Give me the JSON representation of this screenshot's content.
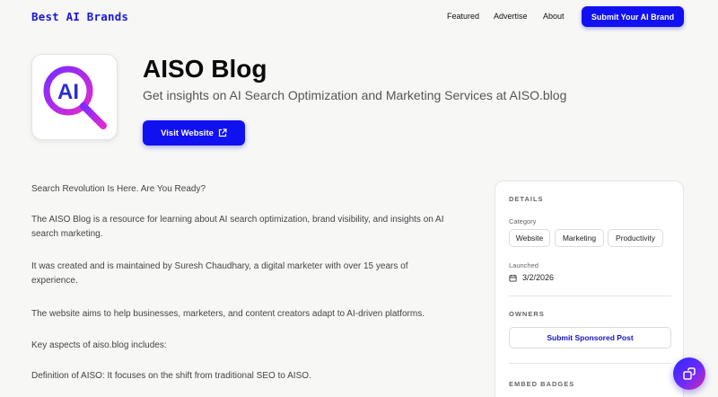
{
  "header": {
    "brand": "Best AI Brands",
    "nav": [
      "Featured",
      "Advertise",
      "About"
    ],
    "submit_label": "Submit Your AI Brand"
  },
  "hero": {
    "logo_text": "AI",
    "title": "AISO Blog",
    "subtitle": "Get insights on AI Search Optimization and Marketing Services at AISO.blog",
    "visit_label": "Visit Website"
  },
  "article": {
    "paragraphs": [
      "Search Revolution Is Here. Are You Ready?",
      "The AISO Blog is a resource for learning about AI search optimization, brand visibility, and insights on AI search marketing.",
      "It was created and is maintained by Suresh Chaudhary, a digital marketer with over 15 years of experience.",
      "The website aims to help businesses, marketers, and content creators adapt to AI-driven platforms.",
      "Key aspects of aiso.blog includes:",
      "Definition of AISO: It focuses on the shift from traditional SEO to AISO."
    ]
  },
  "details": {
    "heading": "DETAILS",
    "category_label": "Category",
    "categories": [
      "Website",
      "Marketing",
      "Productivity"
    ],
    "launched_label": "Launched",
    "launched_date": "3/2/2026",
    "owners_heading": "OWNERS",
    "sponsor_label": "Submit Sponsored Post",
    "embed_heading": "EMBED BADGES"
  },
  "colors": {
    "accent": "#1010f0",
    "brand_text": "#1a1ad6",
    "logo_gradient_start": "#7a2cff",
    "logo_gradient_end": "#e12ad0"
  }
}
